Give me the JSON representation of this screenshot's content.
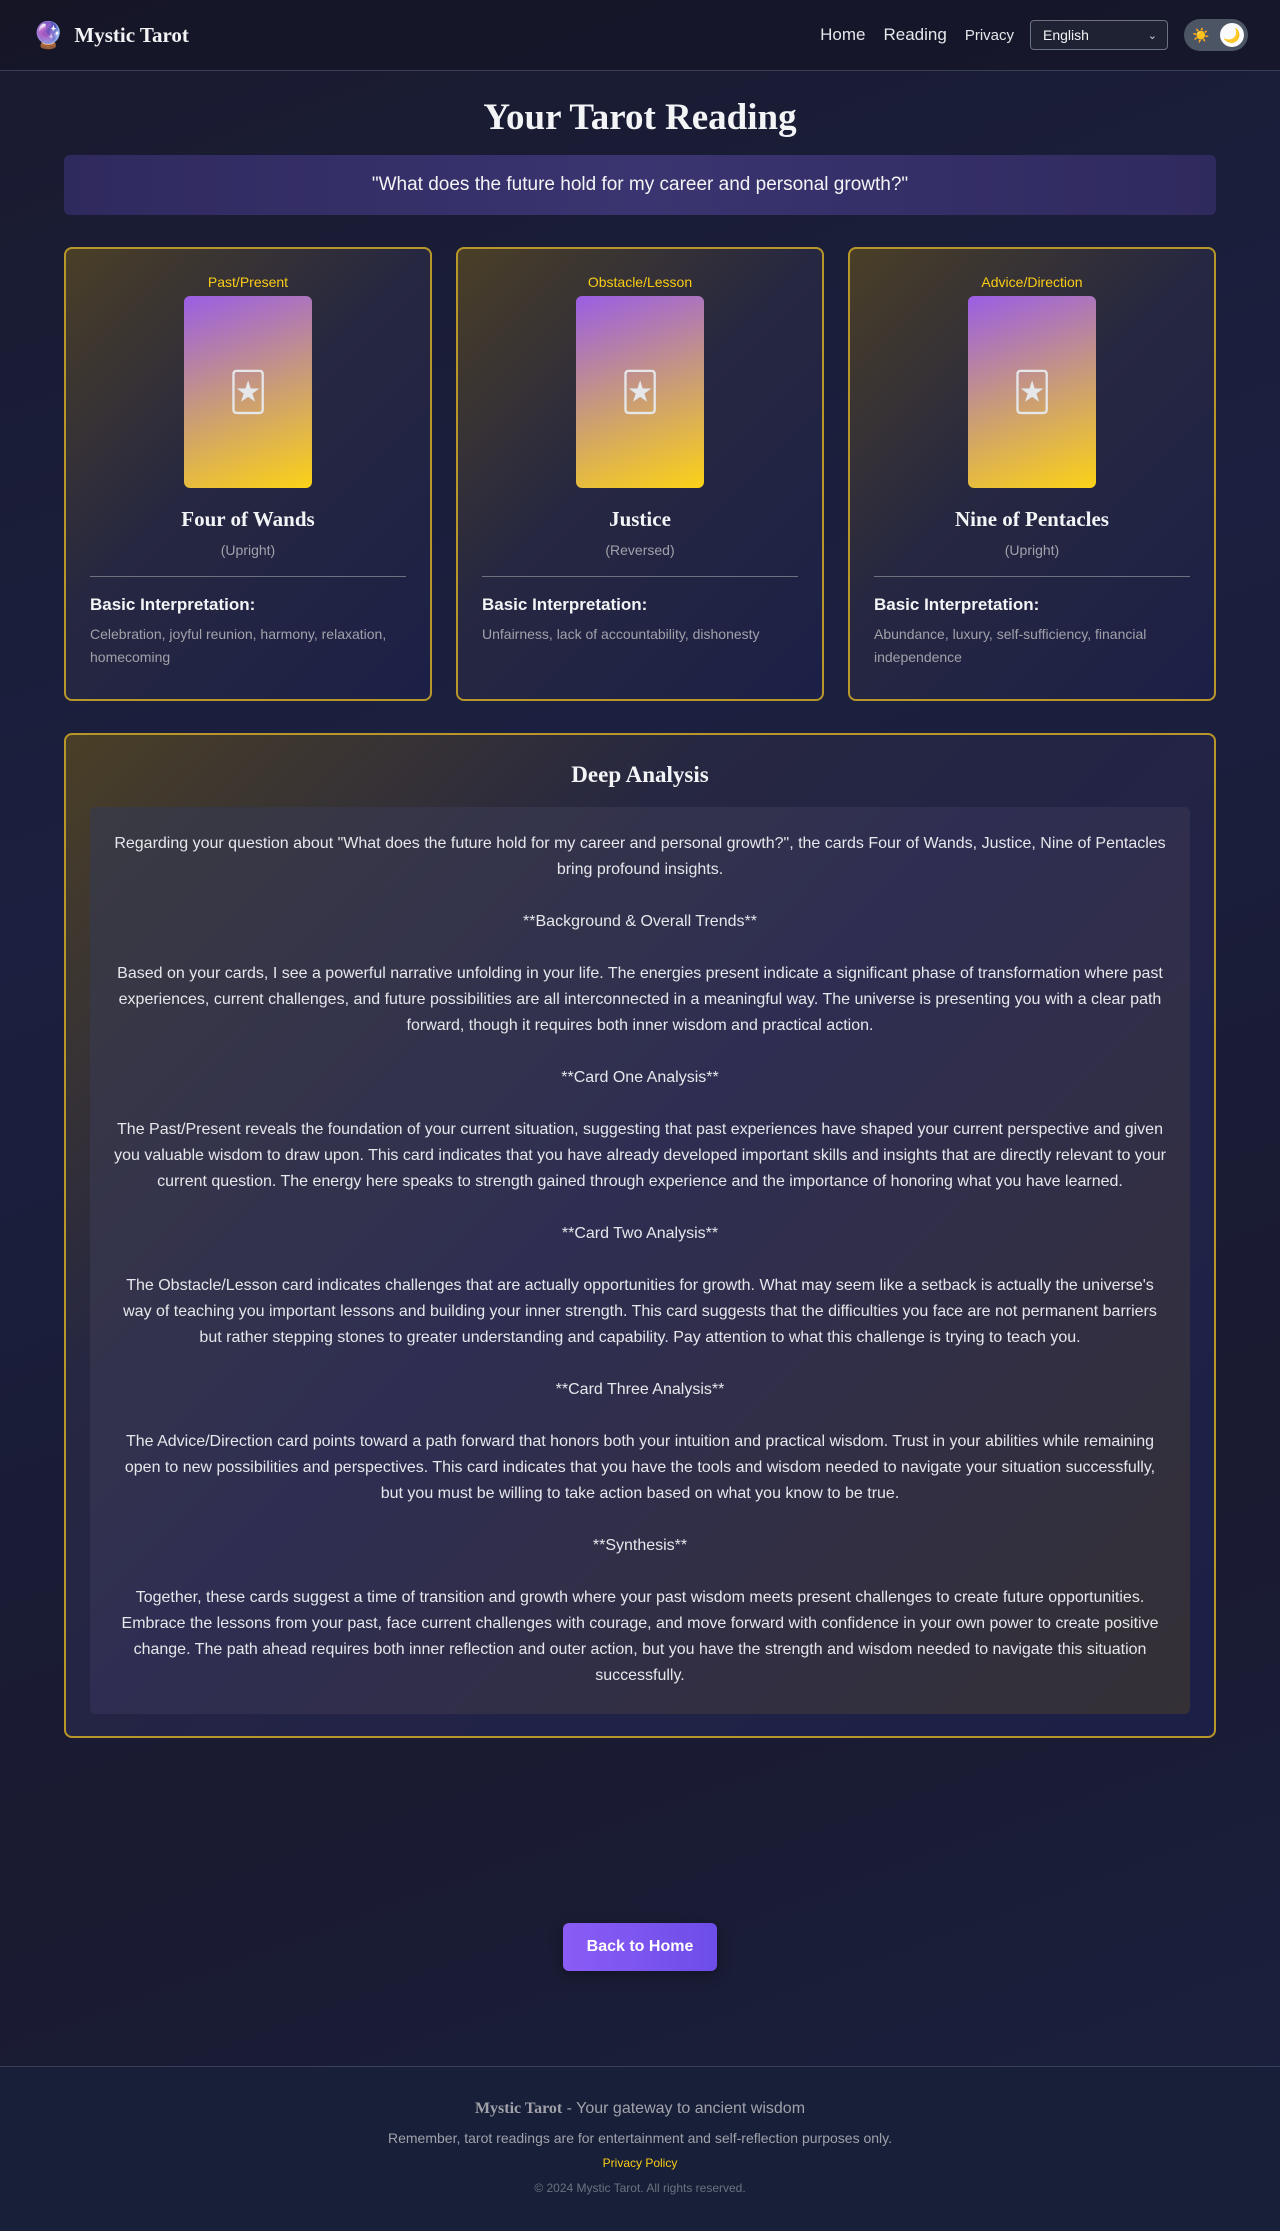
{
  "header": {
    "brand_icon": "🔮",
    "brand_name": "Mystic Tarot",
    "nav": {
      "home": "Home",
      "reading": "Reading",
      "privacy": "Privacy"
    },
    "language": "English",
    "theme_toggle": {
      "sun": "☀️",
      "moon": "🌙"
    }
  },
  "page": {
    "title": "Your Tarot Reading",
    "question": "\"What does the future hold for my career and personal growth?\""
  },
  "cards": [
    {
      "position": "Past/Present",
      "image_icon": "🃏",
      "name": "Four of Wands",
      "orientation": "(Upright)",
      "interp_title": "Basic Interpretation:",
      "interp": "Celebration, joyful reunion, harmony, relaxation, homecoming"
    },
    {
      "position": "Obstacle/Lesson",
      "image_icon": "🃏",
      "name": "Justice",
      "orientation": "(Reversed)",
      "interp_title": "Basic Interpretation:",
      "interp": "Unfairness, lack of accountability, dishonesty"
    },
    {
      "position": "Advice/Direction",
      "image_icon": "🃏",
      "name": "Nine of Pentacles",
      "orientation": "(Upright)",
      "interp_title": "Basic Interpretation:",
      "interp": "Abundance, luxury, self-sufficiency, financial independence"
    }
  ],
  "analysis": {
    "title": "Deep Analysis",
    "paragraphs": [
      "Regarding your question about \"What does the future hold for my career and personal growth?\", the cards Four of Wands, Justice, Nine of Pentacles bring profound insights.",
      "**Background & Overall Trends**",
      "Based on your cards, I see a powerful narrative unfolding in your life. The energies present indicate a significant phase of transformation where past experiences, current challenges, and future possibilities are all interconnected in a meaningful way. The universe is presenting you with a clear path forward, though it requires both inner wisdom and practical action.",
      "**Card One Analysis**",
      "The Past/Present reveals the foundation of your current situation, suggesting that past experiences have shaped your current perspective and given you valuable wisdom to draw upon. This card indicates that you have already developed important skills and insights that are directly relevant to your current question. The energy here speaks to strength gained through experience and the importance of honoring what you have learned.",
      "**Card Two Analysis**",
      "The Obstacle/Lesson card indicates challenges that are actually opportunities for growth. What may seem like a setback is actually the universe's way of teaching you important lessons and building your inner strength. This card suggests that the difficulties you face are not permanent barriers but rather stepping stones to greater understanding and capability. Pay attention to what this challenge is trying to teach you.",
      "**Card Three Analysis**",
      "The Advice/Direction card points toward a path forward that honors both your intuition and practical wisdom. Trust in your abilities while remaining open to new possibilities and perspectives. This card indicates that you have the tools and wisdom needed to navigate your situation successfully, but you must be willing to take action based on what you know to be true.",
      "**Synthesis**",
      "Together, these cards suggest a time of transition and growth where your past wisdom meets present challenges to create future opportunities. Embrace the lessons from your past, face current challenges with courage, and move forward with confidence in your own power to create positive change. The path ahead requires both inner reflection and outer action, but you have the strength and wisdom needed to navigate this situation successfully."
    ]
  },
  "actions": {
    "back_home": "Back to Home"
  },
  "footer": {
    "brand": "Mystic Tarot",
    "tagline": " - Your gateway to ancient wisdom",
    "disclaimer": "Remember, tarot readings are for entertainment and self-reflection purposes only.",
    "privacy_link": "Privacy Policy",
    "copyright": "© 2024 Mystic Tarot. All rights reserved."
  }
}
